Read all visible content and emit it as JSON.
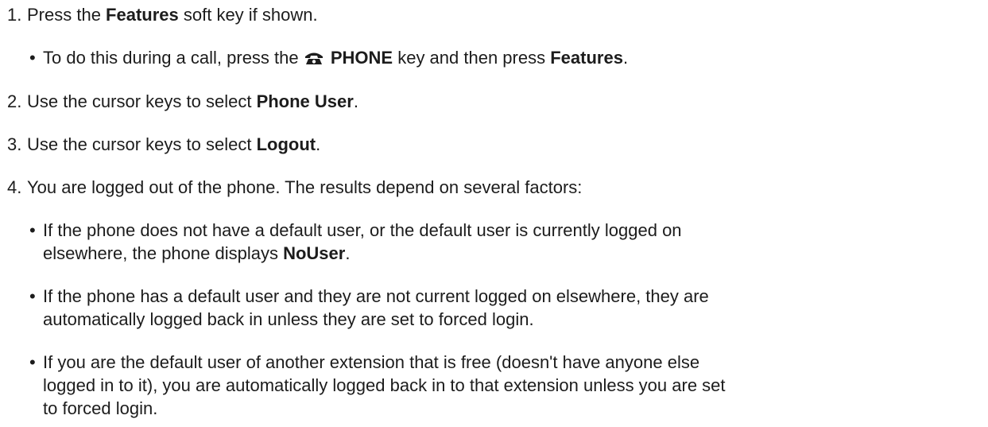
{
  "steps": [
    {
      "number": "1.",
      "parts": [
        "Press the ",
        "Features",
        " soft key if shown."
      ],
      "subs": [
        {
          "bullet": "•",
          "lines": [
            [
              "To do this during a call, press the ",
              "",
              " PHONE",
              " key and then press ",
              "Features",
              "."
            ]
          ]
        }
      ]
    },
    {
      "number": "2.",
      "parts": [
        "Use the cursor keys to select ",
        "Phone User",
        "."
      ]
    },
    {
      "number": "3.",
      "parts": [
        "Use the cursor keys to select ",
        "Logout",
        "."
      ]
    },
    {
      "number": "4.",
      "parts": [
        "You are logged out of the phone. The results depend on several factors:"
      ],
      "subs": [
        {
          "bullet": "•",
          "lines": [
            [
              "If the phone does not have a default user, or the default user is currently logged on"
            ],
            [
              "elsewhere, the phone displays ",
              "NoUser",
              "."
            ]
          ]
        },
        {
          "bullet": "•",
          "lines": [
            [
              "If the phone has a default user and they are not current logged on elsewhere, they are"
            ],
            [
              "automatically logged back in unless they are set to forced login."
            ]
          ]
        },
        {
          "bullet": "•",
          "lines": [
            [
              "If you are the default user of another extension that is free (doesn't have anyone else"
            ],
            [
              "logged in to it), you are automatically logged back in to that extension unless you are set"
            ],
            [
              "to forced login."
            ]
          ]
        }
      ]
    }
  ],
  "icons": {
    "phone_key": "phone-icon"
  }
}
